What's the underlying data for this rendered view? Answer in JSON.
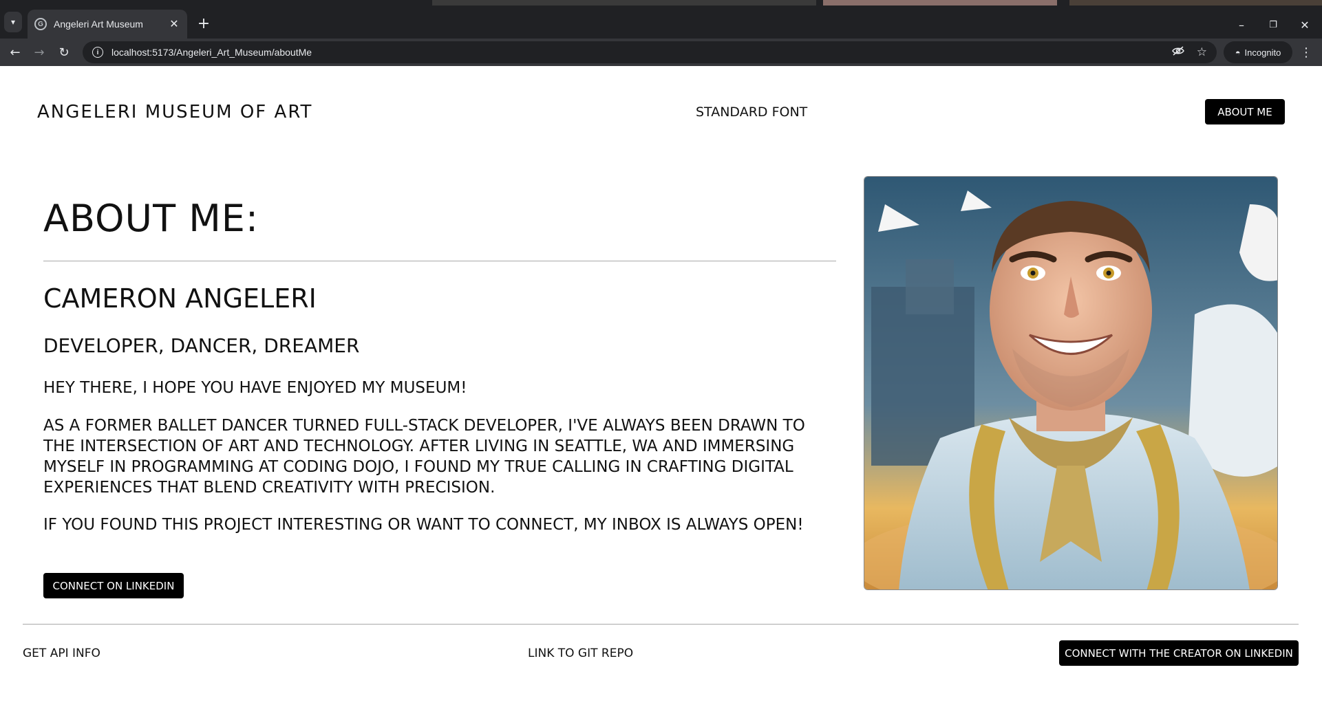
{
  "browser": {
    "tab": {
      "title": "Angeleri Art Museum",
      "favicon_letter": "G",
      "close_glyph": "✕"
    },
    "tab_dropdown_icon": "chevron-down-icon",
    "new_tab_glyph": "+",
    "window_controls": {
      "minimize": "–",
      "restore": "❐",
      "close": "✕"
    },
    "nav": {
      "back": "←",
      "forward": "→",
      "reload": "↻"
    },
    "address": {
      "url": "localhost:5173/Angeleri_Art_Museum/aboutMe",
      "info_glyph": "i"
    },
    "omnibox_icons": {
      "eye_off": "◌",
      "star": "☆"
    },
    "incognito": {
      "label": "Incognito",
      "glyph": "◓"
    },
    "menu_glyph": "⋮",
    "colors": {
      "frame": "#202124",
      "toolbar": "#35363a",
      "text": "#e8eaed"
    }
  },
  "header": {
    "site_title": "ANGELERI MUSEUM OF ART",
    "font_toggle": "STANDARD FONT",
    "about_button": "ABOUT ME"
  },
  "main": {
    "heading": "ABOUT ME:",
    "name": "CAMERON ANGELERI",
    "tagline": "DEVELOPER, DANCER, DREAMER",
    "greeting": "HEY THERE, I HOPE YOU HAVE ENJOYED MY MUSEUM!",
    "bio": "AS A FORMER BALLET DANCER TURNED FULL-STACK DEVELOPER, I'VE ALWAYS BEEN DRAWN TO THE INTERSECTION OF ART AND TECHNOLOGY. AFTER LIVING IN SEATTLE, WA AND IMMERSING MYSELF IN PROGRAMMING AT CODING DOJO, I FOUND MY TRUE CALLING IN CRAFTING DIGITAL EXPERIENCES THAT BLEND CREATIVITY WITH PRECISION.",
    "contact": "IF YOU FOUND THIS PROJECT INTERESTING OR WANT TO CONNECT, MY INBOX IS ALWAYS OPEN!",
    "linkedin_button": "CONNECT ON LINKEDIN",
    "portrait_icon": "portrait-image"
  },
  "footer": {
    "api_link": "GET API INFO",
    "git_link": "LINK TO GIT REPO",
    "creator_button": "CONNECT WITH THE CREATOR ON LINKEDIN"
  },
  "colors": {
    "button_bg": "#000000",
    "button_text": "#ffffff",
    "divider": "#a8a8a8"
  }
}
